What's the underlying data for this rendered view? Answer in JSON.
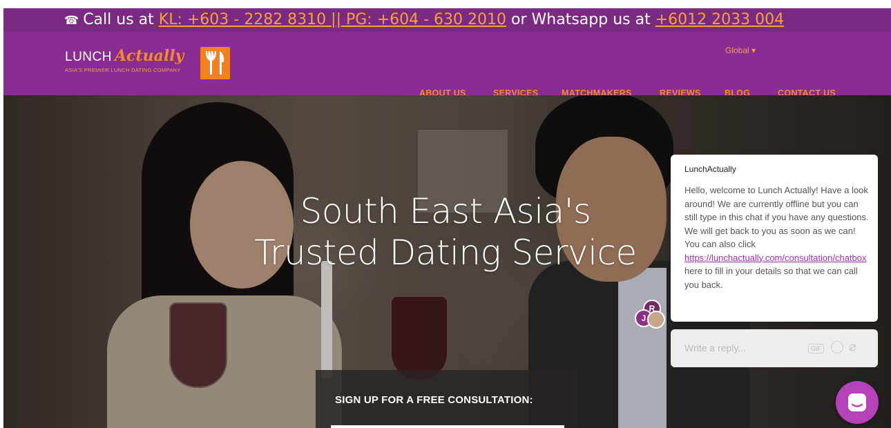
{
  "topbar": {
    "call_prefix": "Call us at",
    "phone_numbers": "KL: +603 - 2282 8310 || PG: +604 - 630 2010",
    "whatsapp_prefix": "or Whatsapp us at",
    "whatsapp_number": "+6012 2033 004",
    "icon": "telephone-icon"
  },
  "header": {
    "logo": {
      "lunch": "LUNCH",
      "actually": "Actually",
      "tagline": "ASIA'S PREMIER LUNCH DATING COMPANY",
      "icon": "fork-knife-icon"
    },
    "region": "Global",
    "nav": [
      "ABOUT US",
      "SERVICES",
      "MATCHMAKERS",
      "REVIEWS",
      "BLOG",
      "CONTACT US"
    ]
  },
  "hero": {
    "title_line1": "South East Asia's",
    "title_line2": "Trusted Dating Service",
    "signup_label": "SIGN UP FOR A FREE CONSULTATION:"
  },
  "chat": {
    "sender": "LunchActually",
    "message_before_link": "Hello, welcome to Lunch Actually! Have a look around! We are currently offline but you can still type in this chat if you have any questions. We will get back to you as soon as we can! You can also click",
    "link": "https://lunchactually.com/consultation/chatbox",
    "message_after_link": "here to fill in your details so that we can call you back.",
    "avatar_initials": [
      "R",
      "J"
    ],
    "reply_placeholder": "Write a reply...",
    "gif_label": "GIF"
  },
  "colors": {
    "purple": "#8a2d92",
    "orange": "#f58a2a",
    "chat_accent": "#b542b8"
  }
}
